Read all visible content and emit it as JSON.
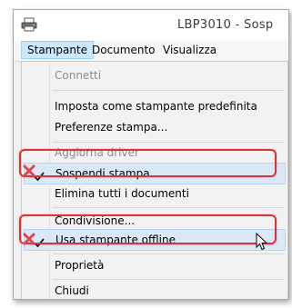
{
  "window": {
    "title": "LBP3010 - Sosp"
  },
  "menubar": {
    "items": [
      "Stampante",
      "Documento",
      "Visualizza"
    ],
    "active": "Stampante"
  },
  "menu": {
    "items": {
      "connetti": "Connetti",
      "imposta_predefinita": "Imposta come stampante predefinita",
      "preferenze": "Preferenze stampa...",
      "aggiorna_driver": "Aggiorna driver",
      "sospendi": "Sospendi stampa",
      "elimina": "Elimina tutti i documenti",
      "condivisione": "Condivisione...",
      "usa_offline": "Usa stampante offline",
      "proprieta": "Proprietà",
      "chiudi": "Chiudi"
    },
    "checked": [
      "Sospendi stampa",
      "Usa stampante offline"
    ],
    "disabled": [
      "Connetti",
      "Aggiorna driver"
    ]
  },
  "icons": {
    "window": "printer-icon",
    "check": "checkmark-icon",
    "annotation": "red-x-icon",
    "pointer": "mouse-cursor-icon"
  },
  "colors": {
    "annotation_red": "#d8343a",
    "menu_highlight": "#cce8ff",
    "checked_row": "#dbe9f7"
  }
}
